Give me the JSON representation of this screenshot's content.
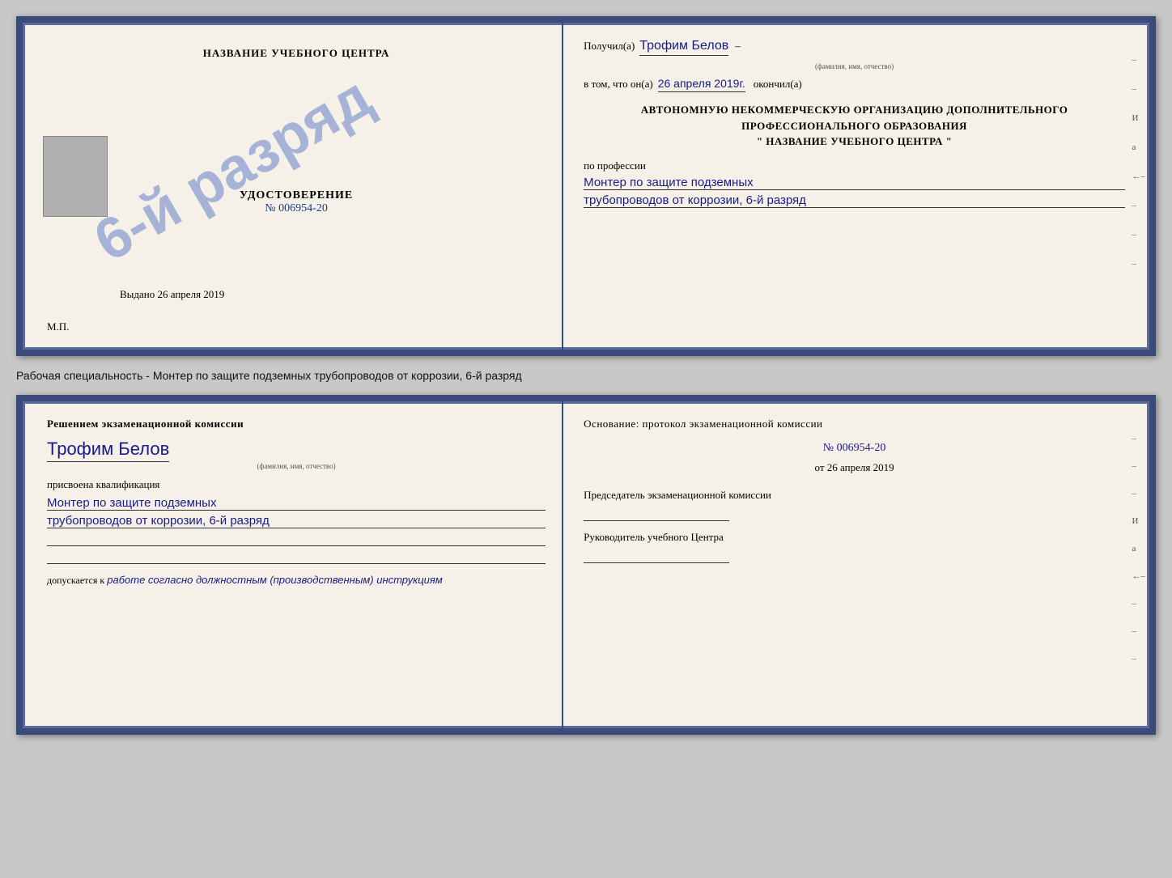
{
  "top_doc": {
    "left": {
      "title": "НАЗВАНИЕ УЧЕБНОГО ЦЕНТРА",
      "udostoverenie_label": "УДОСТОВЕРЕНИЕ",
      "number": "№ 006954-20",
      "stamp_text": "6-й разряд",
      "issued_label": "Выдано",
      "issued_date": "26 апреля 2019",
      "mp_label": "М.П."
    },
    "right": {
      "received_label": "Получил(а)",
      "person_name": "Трофим Белов",
      "person_name_sub": "(фамилия, имя, отчество)",
      "dash1": "–",
      "in_that_label": "в том, что он(а)",
      "date_value": "26 апреля 2019г.",
      "finished_label": "окончил(а)",
      "org_name_block": "АВТОНОМНУЮ НЕКОММЕРЧЕСКУЮ ОРГАНИЗАЦИЮ ДОПОЛНИТЕЛЬНОГО ПРОФЕССИОНАЛЬНОГО ОБРАЗОВАНИЯ",
      "quote_open": "\"",
      "center_name": "НАЗВАНИЕ УЧЕБНОГО ЦЕНТРА",
      "quote_close": "\"",
      "profession_label": "по профессии",
      "profession_line1": "Монтер по защите подземных",
      "profession_line2": "трубопроводов от коррозии, 6-й разряд",
      "side_marks": [
        "-",
        "-",
        "И",
        "а",
        "←",
        "-",
        "-",
        "-"
      ]
    }
  },
  "middle": {
    "text": "Рабочая специальность - Монтер по защите подземных трубопроводов от коррозии, 6-й разряд"
  },
  "bottom_doc": {
    "left": {
      "section_title": "Решением экзаменационной комиссии",
      "person_name": "Трофим Белов",
      "person_name_sub": "(фамилия, имя, отчество)",
      "assigned_label": "присвоена квалификация",
      "profession_line1": "Монтер по защите подземных",
      "profession_line2": "трубопроводов от коррозии, 6-й разряд",
      "допускается_label": "допускается к",
      "допускается_value": "работе согласно должностным (производственным) инструкциям"
    },
    "right": {
      "osnov_label": "Основание: протокол экзаменационной комиссии",
      "protocol_number": "№ 006954-20",
      "date_prefix": "от",
      "date_value": "26 апреля 2019",
      "predsedatel_label": "Председатель экзаменационной комиссии",
      "rukovoditel_label": "Руководитель учебного Центра",
      "side_marks": [
        "-",
        "-",
        "-",
        "И",
        "а",
        "←",
        "-",
        "-",
        "-"
      ]
    }
  }
}
